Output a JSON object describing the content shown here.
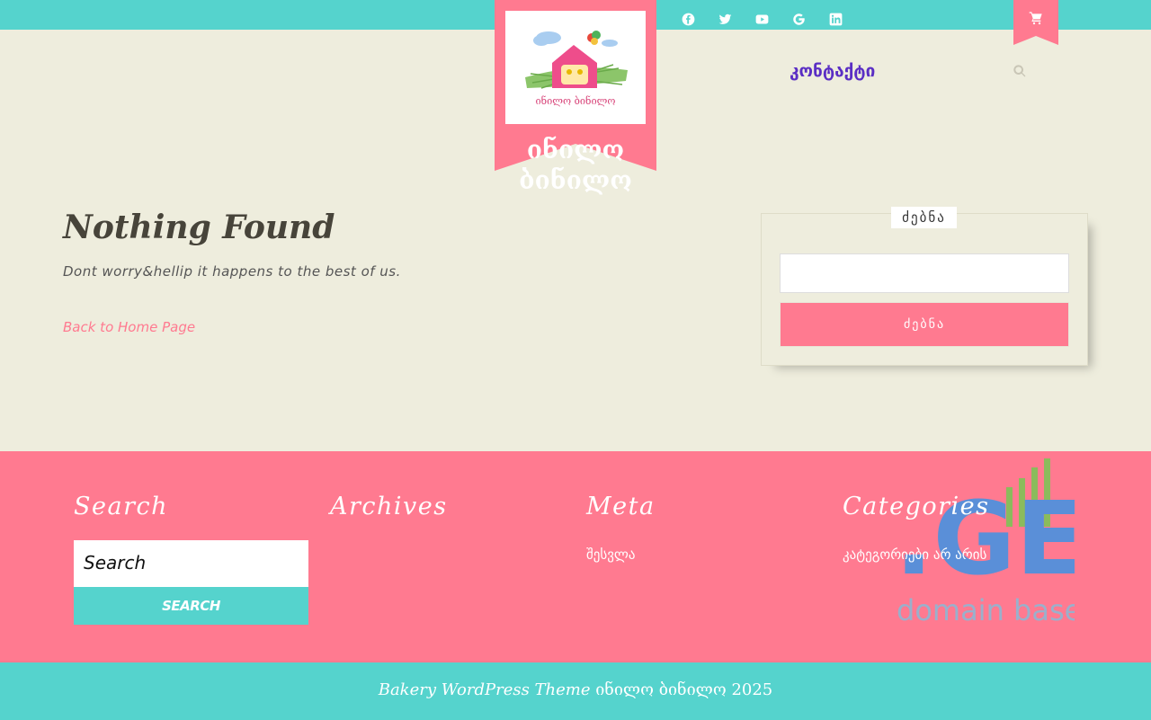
{
  "header": {
    "social_icons": [
      "facebook-icon",
      "twitter-icon",
      "youtube-icon",
      "google-icon",
      "linkedin-icon"
    ],
    "site_title": "ინილო ბინილო",
    "logo_text": "ინილო ბინილო",
    "nav_contact": "კონტაქტი"
  },
  "main": {
    "title": "Nothing Found",
    "message": "Dont worry&hellip it happens to the best of us.",
    "back_link": "Back to Home Page"
  },
  "sidebar": {
    "search_widget_title": "ძებნა",
    "search_button": "ძებნა"
  },
  "footer": {
    "search_heading": "Search",
    "search_placeholder": "Search",
    "search_button": "SEARCH",
    "archives_heading": "Archives",
    "meta_heading": "Meta",
    "meta_link": "შესვლა",
    "categories_heading": "Categories",
    "categories_text": "კატეგორიები არ არის",
    "watermark_brand": ".GE",
    "watermark_text": "domain base",
    "copyright_theme": "Bakery WordPress Theme",
    "copyright_rest": " ინილო ბინილო 2025"
  },
  "colors": {
    "accent_teal": "#55d3cd",
    "accent_pink": "#ff7a90",
    "background": "#eeeddd",
    "nav_purple": "#5a2ec4"
  }
}
